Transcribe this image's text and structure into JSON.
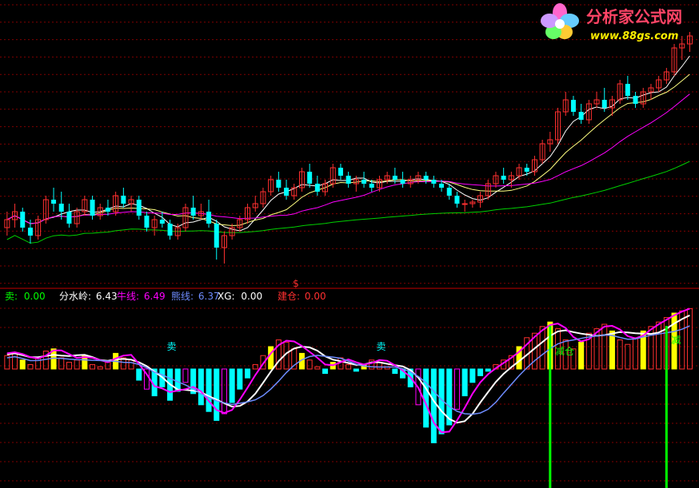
{
  "watermark": {
    "title": "分析家公式网",
    "url": "www.88gs.com"
  },
  "indicator_legend": [
    {
      "label": "卖:",
      "value": "0.00",
      "color": "#00ff00"
    },
    {
      "label": "分水岭:",
      "value": "6.43",
      "color": "#ffffff"
    },
    {
      "label": "牛线:",
      "value": "6.49",
      "color": "#ff00ff"
    },
    {
      "label": "熊线:",
      "value": "6.37",
      "color": "#6e8cff"
    },
    {
      "label": "XG:",
      "value": "0.00",
      "color": "#ffffff"
    },
    {
      "label": "建仓:",
      "value": "0.00",
      "color": "#ff3030"
    }
  ],
  "panel_marker": "$",
  "signals": [
    {
      "text": "卖",
      "color": "#00ffff"
    },
    {
      "text": "卖",
      "color": "#00ffff"
    },
    {
      "text": "减仓",
      "color": "#00ff00"
    },
    {
      "text": "减",
      "color": "#00ff00"
    }
  ],
  "colors": {
    "up": "#ff3030",
    "down": "#00ffff",
    "ma_short": "#ffffff",
    "ma_mid": "#ffff80",
    "ma_long": "#ff00ff",
    "ma_longest": "#00d000",
    "grid": "#800000",
    "divider": "#c00000",
    "watershed": "#ffffff",
    "bull": "#ff00ff",
    "bear": "#6e8cff",
    "buy_bar": "#ffff00",
    "sell_line": "#00ff00"
  },
  "chart_data": {
    "type": "candlestick",
    "candles": [
      [
        6.0,
        6.2,
        5.9,
        6.1
      ],
      [
        6.1,
        6.3,
        6.0,
        6.2
      ],
      [
        6.2,
        6.25,
        5.95,
        6.0
      ],
      [
        6.0,
        6.1,
        5.8,
        5.9
      ],
      [
        5.9,
        6.15,
        5.85,
        6.1
      ],
      [
        6.1,
        6.4,
        6.05,
        6.35
      ],
      [
        6.35,
        6.5,
        6.2,
        6.3
      ],
      [
        6.3,
        6.45,
        6.1,
        6.2
      ],
      [
        6.2,
        6.3,
        6.0,
        6.05
      ],
      [
        6.05,
        6.25,
        6.0,
        6.2
      ],
      [
        6.2,
        6.4,
        6.15,
        6.35
      ],
      [
        6.35,
        6.4,
        6.1,
        6.15
      ],
      [
        6.15,
        6.3,
        6.1,
        6.25
      ],
      [
        6.25,
        6.35,
        6.15,
        6.2
      ],
      [
        6.2,
        6.45,
        6.15,
        6.4
      ],
      [
        6.4,
        6.5,
        6.25,
        6.3
      ],
      [
        6.3,
        6.4,
        6.2,
        6.35
      ],
      [
        6.35,
        6.4,
        6.1,
        6.15
      ],
      [
        6.15,
        6.2,
        5.95,
        6.0
      ],
      [
        6.0,
        6.15,
        5.9,
        6.1
      ],
      [
        6.1,
        6.2,
        6.0,
        6.05
      ],
      [
        6.05,
        6.1,
        5.85,
        5.9
      ],
      [
        5.9,
        6.05,
        5.85,
        6.0
      ],
      [
        6.0,
        6.3,
        5.95,
        6.25
      ],
      [
        6.25,
        6.4,
        6.1,
        6.15
      ],
      [
        6.15,
        6.3,
        6.1,
        6.2
      ],
      [
        6.2,
        6.35,
        6.0,
        6.05
      ],
      [
        6.05,
        6.1,
        5.6,
        5.75
      ],
      [
        5.75,
        5.95,
        5.55,
        5.9
      ],
      [
        5.9,
        6.05,
        5.85,
        6.0
      ],
      [
        6.0,
        6.15,
        5.95,
        6.1
      ],
      [
        6.1,
        6.3,
        6.05,
        6.25
      ],
      [
        6.25,
        6.4,
        6.2,
        6.3
      ],
      [
        6.3,
        6.5,
        6.25,
        6.45
      ],
      [
        6.45,
        6.65,
        6.4,
        6.6
      ],
      [
        6.6,
        6.7,
        6.45,
        6.5
      ],
      [
        6.5,
        6.6,
        6.35,
        6.4
      ],
      [
        6.4,
        6.55,
        6.35,
        6.5
      ],
      [
        6.5,
        6.75,
        6.45,
        6.7
      ],
      [
        6.7,
        6.8,
        6.5,
        6.55
      ],
      [
        6.55,
        6.65,
        6.4,
        6.45
      ],
      [
        6.45,
        6.6,
        6.4,
        6.55
      ],
      [
        6.55,
        6.8,
        6.5,
        6.75
      ],
      [
        6.75,
        6.8,
        6.6,
        6.65
      ],
      [
        6.65,
        6.7,
        6.5,
        6.55
      ],
      [
        6.55,
        6.65,
        6.45,
        6.6
      ],
      [
        6.6,
        6.7,
        6.5,
        6.55
      ],
      [
        6.55,
        6.6,
        6.45,
        6.5
      ],
      [
        6.5,
        6.65,
        6.45,
        6.6
      ],
      [
        6.6,
        6.7,
        6.55,
        6.65
      ],
      [
        6.65,
        6.75,
        6.55,
        6.6
      ],
      [
        6.6,
        6.7,
        6.5,
        6.55
      ],
      [
        6.55,
        6.65,
        6.5,
        6.6
      ],
      [
        6.6,
        6.7,
        6.55,
        6.65
      ],
      [
        6.65,
        6.7,
        6.55,
        6.6
      ],
      [
        6.6,
        6.65,
        6.5,
        6.55
      ],
      [
        6.55,
        6.6,
        6.45,
        6.5
      ],
      [
        6.5,
        6.55,
        6.35,
        6.4
      ],
      [
        6.4,
        6.45,
        6.25,
        6.3
      ],
      [
        6.3,
        6.35,
        6.2,
        6.3
      ],
      [
        6.3,
        6.35,
        6.25,
        6.32
      ],
      [
        6.32,
        6.45,
        6.25,
        6.4
      ],
      [
        6.4,
        6.6,
        6.35,
        6.55
      ],
      [
        6.55,
        6.7,
        6.5,
        6.65
      ],
      [
        6.65,
        6.75,
        6.55,
        6.6
      ],
      [
        6.6,
        6.7,
        6.5,
        6.65
      ],
      [
        6.65,
        6.8,
        6.6,
        6.75
      ],
      [
        6.75,
        6.8,
        6.65,
        6.7
      ],
      [
        6.7,
        6.9,
        6.65,
        6.85
      ],
      [
        6.85,
        7.1,
        6.8,
        7.05
      ],
      [
        7.05,
        7.2,
        6.95,
        7.1
      ],
      [
        7.1,
        7.5,
        7.05,
        7.45
      ],
      [
        7.45,
        7.7,
        7.4,
        7.6
      ],
      [
        7.6,
        7.65,
        7.4,
        7.45
      ],
      [
        7.45,
        7.55,
        7.3,
        7.35
      ],
      [
        7.35,
        7.6,
        7.3,
        7.55
      ],
      [
        7.55,
        7.7,
        7.5,
        7.6
      ],
      [
        7.6,
        7.75,
        7.45,
        7.5
      ],
      [
        7.5,
        7.65,
        7.4,
        7.6
      ],
      [
        7.6,
        7.85,
        7.55,
        7.8
      ],
      [
        7.8,
        7.9,
        7.6,
        7.65
      ],
      [
        7.65,
        7.7,
        7.5,
        7.55
      ],
      [
        7.55,
        7.75,
        7.5,
        7.7
      ],
      [
        7.7,
        7.8,
        7.6,
        7.75
      ],
      [
        7.75,
        7.9,
        7.7,
        7.85
      ],
      [
        7.85,
        8.0,
        7.8,
        7.95
      ],
      [
        7.95,
        8.3,
        7.9,
        8.25
      ],
      [
        8.25,
        8.4,
        8.1,
        8.3
      ],
      [
        8.3,
        8.45,
        8.2,
        8.4
      ]
    ],
    "ma_periods": [
      5,
      10,
      20,
      60
    ],
    "signal_candles": [
      21,
      48,
      70,
      85
    ],
    "indicator_bars": [
      0.6,
      0.7,
      0.4,
      0.2,
      0.5,
      0.8,
      0.9,
      0.5,
      0.3,
      0.4,
      0.6,
      0.2,
      0.1,
      0.3,
      0.7,
      0.5,
      0.4,
      -0.5,
      -0.9,
      -1.2,
      -0.8,
      -1.4,
      -1.0,
      -0.6,
      -1.1,
      -1.6,
      -1.9,
      -2.3,
      -2.0,
      -1.5,
      -0.9,
      -0.4,
      0.2,
      0.6,
      1.0,
      1.3,
      1.2,
      0.9,
      0.7,
      0.4,
      0.1,
      -0.2,
      0.3,
      0.5,
      0.2,
      -0.1,
      0.2,
      0.4,
      0.3,
      0.1,
      -0.2,
      -0.4,
      -0.8,
      -1.6,
      -2.6,
      -3.3,
      -2.9,
      -2.5,
      -1.8,
      -1.2,
      -0.6,
      -0.3,
      -0.1,
      0.2,
      0.4,
      0.6,
      1.0,
      1.4,
      1.6,
      1.9,
      2.1,
      1.8,
      1.3,
      0.9,
      1.2,
      1.6,
      1.8,
      2.0,
      1.7,
      1.3,
      1.1,
      1.4,
      1.7,
      1.9,
      2.1,
      2.3,
      2.5,
      2.6,
      2.7
    ]
  }
}
